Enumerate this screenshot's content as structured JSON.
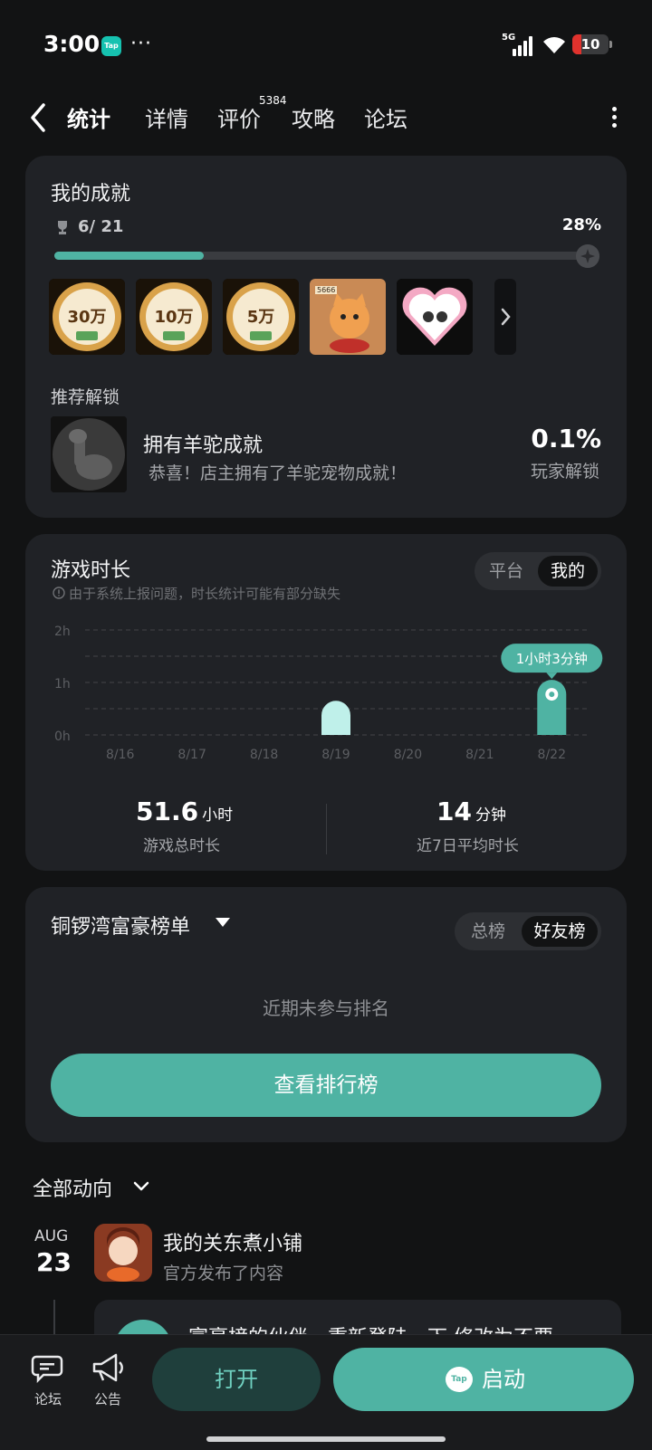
{
  "status_bar": {
    "time": "3:00",
    "app_badge": "Tap",
    "dots": "···",
    "network": "5G",
    "battery": "10"
  },
  "nav": {
    "tabs": [
      {
        "label": "统计",
        "active": true
      },
      {
        "label": "详情",
        "active": false
      },
      {
        "label": "评价",
        "active": false,
        "badge": "5384"
      },
      {
        "label": "攻略",
        "active": false
      },
      {
        "label": "论坛",
        "active": false
      }
    ]
  },
  "achievements": {
    "title": "我的成就",
    "count": "6/ 21",
    "percent": "28%",
    "progress": 0.28,
    "badges": [
      {
        "icon": "coin-badge-icon",
        "text": "30万"
      },
      {
        "icon": "coin-badge-icon",
        "text": "10万"
      },
      {
        "icon": "coin-badge-icon",
        "text": "5万"
      },
      {
        "icon": "cat-badge-icon",
        "text": "5666"
      },
      {
        "icon": "heart-couple-badge-icon",
        "text": ""
      }
    ],
    "recommend_label": "推荐解锁",
    "recommend": {
      "icon": "alpaca-icon",
      "title": "拥有羊驼成就",
      "desc": "恭喜！店主拥有了羊驼宠物成就！",
      "percent": "0.1%",
      "percent_label": "玩家解锁"
    }
  },
  "playtime": {
    "title": "游戏时长",
    "warning": "由于系统上报问题，时长统计可能有部分缺失",
    "toggle": {
      "platform": "平台",
      "mine": "我的",
      "selected": "mine"
    },
    "total_value": "51.6",
    "total_unit": "小时",
    "total_label": "游戏总时长",
    "avg_value": "14",
    "avg_unit": "分钟",
    "avg_label": "近7日平均时长"
  },
  "chart_data": {
    "type": "bar",
    "categories": [
      "8/16",
      "8/17",
      "8/18",
      "8/19",
      "8/20",
      "8/21",
      "8/22"
    ],
    "values": [
      0,
      0,
      0,
      0.65,
      0,
      0,
      1.05
    ],
    "ylim": [
      0,
      2
    ],
    "yticks": [
      "0h",
      "1h",
      "2h"
    ],
    "highlight_index": 6,
    "highlight_label": "1小时3分钟",
    "colors": {
      "bar": "#bff0ea",
      "highlight": "#4fb3a3"
    },
    "grid": true
  },
  "leaderboard": {
    "title": "铜锣湾富豪榜单",
    "toggle": {
      "overall": "总榜",
      "friends": "好友榜",
      "selected": "friends"
    },
    "empty_text": "近期未参与排名",
    "button": "查看排行榜"
  },
  "feed": {
    "title": "全部动向",
    "month": "AUG",
    "day": "23",
    "game_name": "我的关东煮小铺",
    "game_sub": "官方发布了内容",
    "post_text": "富豪榜的伙伴，重新登陆一下 修改为不要"
  },
  "bottom_bar": {
    "forum": "论坛",
    "notice": "公告",
    "open": "打开",
    "start": "启动",
    "start_logo": "Tap"
  },
  "colors": {
    "accent": "#4fb3a3",
    "card": "#202226",
    "background": "#121314"
  }
}
